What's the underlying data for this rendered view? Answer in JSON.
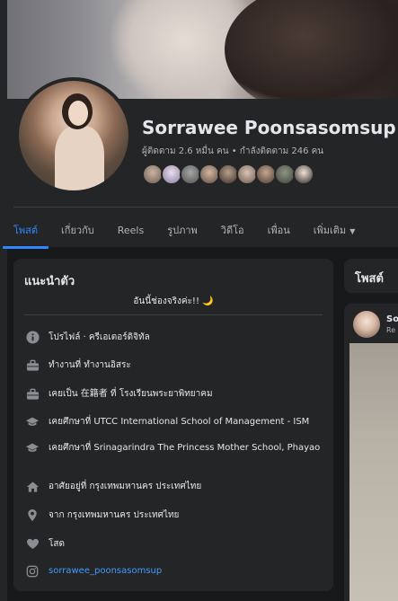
{
  "profile": {
    "name": "Sorrawee Poonsasomsup",
    "stats": "ผู้ติดตาม 2.6 หมื่น คน • กำลังติดตาม 246 คน"
  },
  "tabs": [
    {
      "label": "โพสต์"
    },
    {
      "label": "เกี่ยวกับ"
    },
    {
      "label": "Reels"
    },
    {
      "label": "รูปภาพ"
    },
    {
      "label": "วิดีโอ"
    },
    {
      "label": "เพื่อน"
    },
    {
      "label": "เพิ่มเติม"
    }
  ],
  "intro": {
    "title": "แนะนำตัว",
    "bio": "อันนี้ช่องจริงค่ะ!! 🌙",
    "items": [
      {
        "icon": "info-icon",
        "text": "โปรไฟล์ · ครีเอเตอร์ดิจิทัล"
      },
      {
        "icon": "briefcase-icon",
        "text": "ทำงานที่ ทำงานอิสระ"
      },
      {
        "icon": "briefcase-icon",
        "text": "เคยเป็น 在籍者 ที่ โรงเรียนพระยาพิทยาคม"
      },
      {
        "icon": "graduation-cap-icon",
        "text": "เคยศึกษาที่ UTCC International School of Management - ISM"
      },
      {
        "icon": "graduation-cap-icon",
        "text": "เคยศึกษาที่ Srinagarindra The Princess Mother School, Phayao"
      },
      {
        "icon": "home-icon",
        "text": "อาศัยอยู่ที่ กรุงเทพมหานคร ประเทศไทย"
      },
      {
        "icon": "location-pin-icon",
        "text": "จาก กรุงเทพมหานคร ประเทศไทย"
      },
      {
        "icon": "heart-icon",
        "text": "โสด"
      },
      {
        "icon": "instagram-icon",
        "text": "sorrawee_poonsasomsup"
      }
    ]
  },
  "posts": {
    "title": "โพสต์",
    "author_short": "So",
    "sub_short": "Re"
  },
  "colors": {
    "accent": "#2d88ff",
    "card": "#242526",
    "background": "#18191a",
    "link": "#4599ff"
  }
}
